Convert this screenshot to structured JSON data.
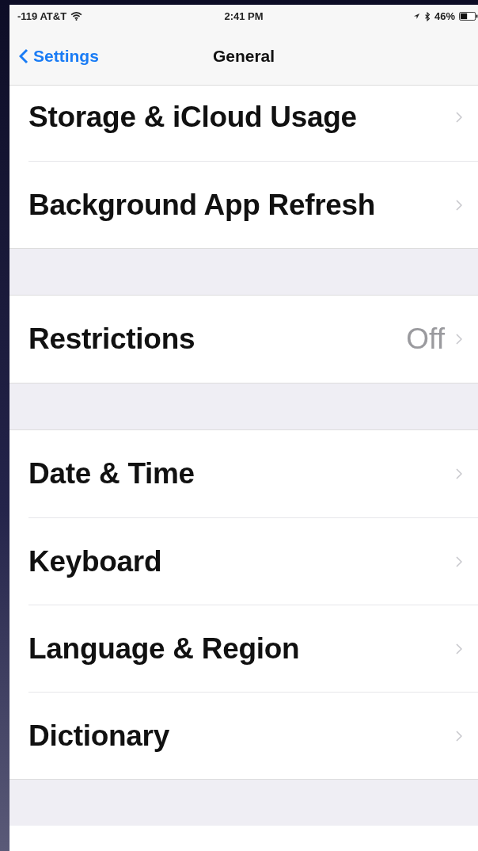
{
  "status_bar": {
    "carrier": "-119 AT&T",
    "time": "2:41 PM",
    "battery": "46%"
  },
  "nav_bar": {
    "back": "Settings",
    "title": "General"
  },
  "sections": [
    {
      "rows": [
        {
          "label": "Storage & iCloud Usage"
        },
        {
          "label": "Background App Refresh"
        }
      ]
    },
    {
      "rows": [
        {
          "label": "Restrictions",
          "value": "Off"
        }
      ]
    },
    {
      "rows": [
        {
          "label": "Date & Time"
        },
        {
          "label": "Keyboard"
        },
        {
          "label": "Language & Region"
        },
        {
          "label": "Dictionary"
        }
      ]
    }
  ]
}
